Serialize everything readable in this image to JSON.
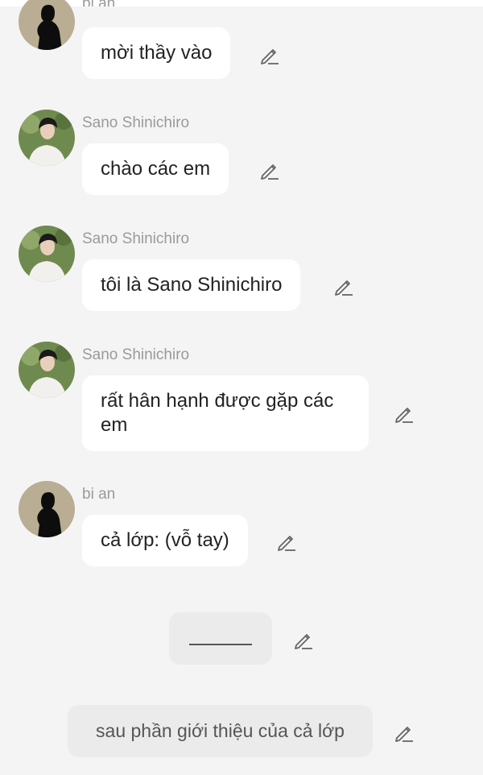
{
  "messages": [
    {
      "sender": "bi an",
      "avatar": "silhouette-avatar",
      "text": "mời thầy vào"
    },
    {
      "sender": "Sano Shinichiro",
      "avatar": "photo-avatar",
      "text": "chào các em"
    },
    {
      "sender": "Sano Shinichiro",
      "avatar": "photo-avatar",
      "text": "tôi là Sano Shinichiro"
    },
    {
      "sender": "Sano Shinichiro",
      "avatar": "photo-avatar",
      "text": "rất hân hạnh được gặp các em"
    },
    {
      "sender": "bi an",
      "avatar": "silhouette-avatar",
      "text": "cả lớp: (vỗ tay)"
    }
  ],
  "narration": [
    {
      "text": ""
    },
    {
      "text": "sau phần giới thiệu của cả lớp"
    }
  ],
  "icons": {
    "edit": "pencil-edit-icon"
  },
  "colors": {
    "background": "#f4f4f4",
    "bubble": "#ffffff",
    "narration_bubble": "#ebebeb",
    "sender_name": "#9a9a9a"
  }
}
